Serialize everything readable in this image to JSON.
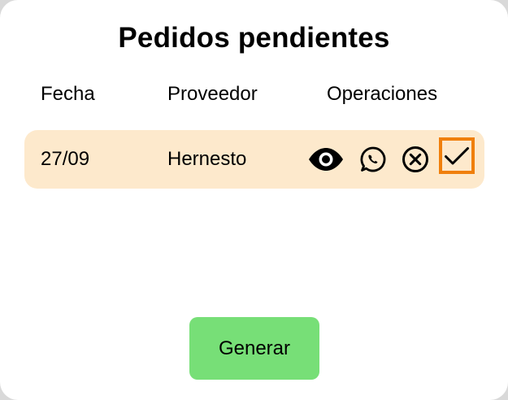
{
  "title": "Pedidos pendientes",
  "columns": {
    "fecha": "Fecha",
    "proveedor": "Proveedor",
    "operaciones": "Operaciones"
  },
  "orders": [
    {
      "fecha": "27/09",
      "proveedor": "Hernesto",
      "operations": [
        "eye-icon",
        "whatsapp-icon",
        "cancel-icon",
        "check-icon"
      ],
      "highlighted_operation": "check-icon"
    }
  ],
  "generate_button": "Generar",
  "colors": {
    "row_background": "#fde9cc",
    "generate_button": "#77df77",
    "highlight_border": "#f07f0c"
  }
}
